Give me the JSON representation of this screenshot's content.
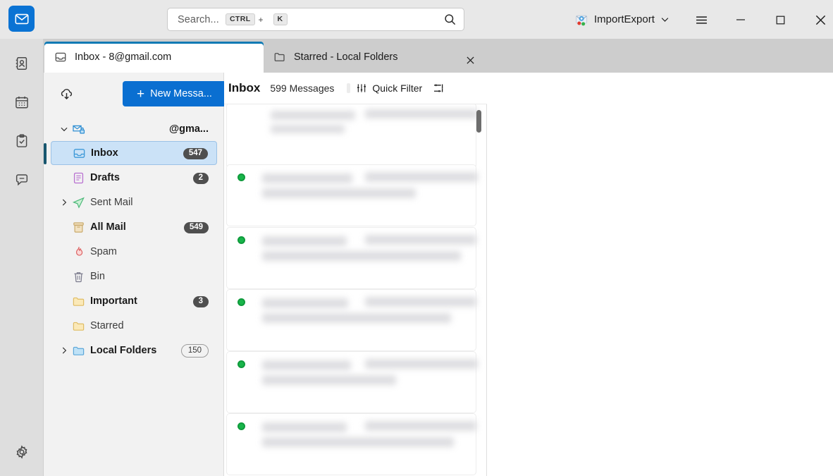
{
  "window": {
    "app_icon": "mail-envelope-icon",
    "account_switcher_label": "ImportExport",
    "account_switcher_icon": "importexport-addon-icon",
    "chevron_icon": "chevron-down-icon",
    "menu_icon": "hamburger-menu-icon",
    "minimize_icon": "minimize-icon",
    "maximize_icon": "maximize-icon",
    "close_icon": "close-icon"
  },
  "search": {
    "placeholder": "Search...",
    "key_modifier": "CTRL",
    "key_plus": "+",
    "key_letter": "K",
    "icon": "search-icon"
  },
  "tabs": [
    {
      "label_prefix": "Inbox - ",
      "label_redacted": "             ",
      "label_suffix": "8@gmail.com",
      "icon": "inbox-tray-icon",
      "active": true
    },
    {
      "label": "Starred - Local Folders",
      "icon": "folder-icon",
      "active": false,
      "close_icon": "close-icon"
    }
  ],
  "rail": {
    "items": [
      {
        "icon": "address-book-icon",
        "name": "address-book"
      },
      {
        "icon": "calendar-icon",
        "name": "calendar"
      },
      {
        "icon": "tasks-clipboard-icon",
        "name": "tasks"
      },
      {
        "icon": "chat-bubble-icon",
        "name": "chat"
      }
    ],
    "settings": {
      "icon": "gear-icon",
      "name": "settings"
    }
  },
  "folder_pane": {
    "get_messages_icon": "cloud-download-icon",
    "new_message_label": "New Messa...",
    "new_message_plus": "+",
    "new_message_color": "#0a6fd1",
    "more_label": "...",
    "account": {
      "twisty": "chevron-down-icon",
      "icon": "secure-mail-icon",
      "label": "@gma..."
    },
    "folders": [
      {
        "label": "Inbox",
        "count": "547",
        "icon": "inbox-tray-icon",
        "bold": true,
        "selected": true,
        "badge": "solid",
        "twisty": ""
      },
      {
        "label": "Drafts",
        "count": "2",
        "icon": "drafts-icon",
        "bold": true,
        "selected": false,
        "badge": "solid",
        "twisty": ""
      },
      {
        "label": "Sent Mail",
        "count": "",
        "icon": "sent-paper-plane-icon",
        "bold": false,
        "selected": false,
        "badge": "",
        "twisty": "chevron-right-icon"
      },
      {
        "label": "All Mail",
        "count": "549",
        "icon": "archive-box-icon",
        "bold": true,
        "selected": false,
        "badge": "solid",
        "twisty": ""
      },
      {
        "label": "Spam",
        "count": "",
        "icon": "flame-icon",
        "bold": false,
        "selected": false,
        "badge": "",
        "twisty": ""
      },
      {
        "label": "Bin",
        "count": "",
        "icon": "trash-icon",
        "bold": false,
        "selected": false,
        "badge": "",
        "twisty": ""
      },
      {
        "label": "Important",
        "count": "3",
        "icon": "folder-icon",
        "bold": true,
        "selected": false,
        "badge": "solid",
        "twisty": ""
      },
      {
        "label": "Starred",
        "count": "",
        "icon": "folder-icon",
        "bold": false,
        "selected": false,
        "badge": "",
        "twisty": ""
      },
      {
        "label": "Local Folders",
        "count": "150",
        "icon": "folder-blue-icon",
        "bold": true,
        "selected": false,
        "badge": "outline",
        "twisty": "chevron-right-icon"
      }
    ]
  },
  "message_list": {
    "title": "Inbox",
    "count_label": "599 Messages",
    "quick_filter_label": "Quick Filter",
    "quick_filter_icon": "sliders-icon",
    "display_options_icon": "display-options-icon",
    "scrollbar": "vertical-scrollbar",
    "rows": [
      {
        "unread": false,
        "redacted": true
      },
      {
        "unread": true,
        "redacted": true
      },
      {
        "unread": true,
        "redacted": true
      },
      {
        "unread": true,
        "redacted": true
      },
      {
        "unread": true,
        "redacted": true
      },
      {
        "unread": true,
        "redacted": true
      }
    ]
  }
}
